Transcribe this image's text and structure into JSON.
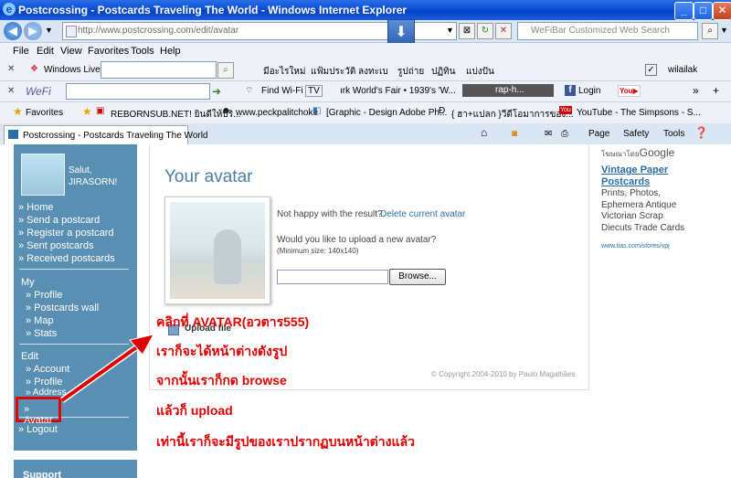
{
  "window": {
    "title": "Postcrossing - Postcards Traveling The World - Windows Internet Explorer"
  },
  "address_bar": {
    "url": "http://www.postcrossing.com/edit/avatar",
    "search_placeholder": "WeFiBar Customized Web Search"
  },
  "menu": [
    "File",
    "Edit",
    "View",
    "Favorites",
    "Tools",
    "Help"
  ],
  "toolbar_live": {
    "label": "Windows Live",
    "links": [
      "มีอะไรใหม่",
      "แฟ้มประวัติ",
      "ลงทะเบ",
      "รูปถ่าย",
      "ปฏิทิน",
      "แบ่งปัน"
    ],
    "user": "wilailak"
  },
  "toolbar_wefi": {
    "label": "WeFi",
    "find_wifi": "Find Wi-Fi",
    "tv": "TV",
    "ticker": "ırk World's Fair • 1939's 'W...",
    "media": "rap-h...",
    "login": "Login"
  },
  "favorites_bar": {
    "label": "Favorites",
    "items": [
      "REBORNSUB.NET! ยินดีให้บริ...",
      "www.peckpalitchoke",
      "[Graphic - Design Adobe Ph...",
      "{ ฮา+แปลก }วีดีโอมาการของ...",
      "YouTube - The Simpsons - S..."
    ]
  },
  "tab": {
    "title": "Postcrossing - Postcards Traveling The World",
    "commands": [
      "Page",
      "Safety",
      "Tools"
    ]
  },
  "sidebar": {
    "greeting": "Salut, JIRASORN!",
    "nav": [
      "» Home",
      "» Send a postcard",
      "» Register a postcard",
      "» Sent postcards",
      "» Received postcards"
    ],
    "my_heading": "My",
    "my_items": [
      "» Profile",
      "» Postcards wall",
      "» Map",
      "» Stats"
    ],
    "edit_heading": "Edit",
    "edit_items": [
      "» Account",
      "» Profile",
      "» Address",
      "» Avatar"
    ],
    "logout": "» Logout",
    "support": "Support"
  },
  "content": {
    "title": "Your avatar",
    "not_happy": "Not happy with the result?",
    "delete_link": "Delete current avatar",
    "upload_question": "Would you like to upload a new avatar?",
    "min_size": "(Minimum size: 140x140)",
    "browse": "Browse...",
    "upload_file": "Upload file",
    "copyright": "© Copyright 2004-2010 by Paulo Magalhães"
  },
  "ad": {
    "by": "โฆษณาโดย",
    "google": "Google",
    "headline": "Vintage Paper Postcards",
    "text": "Prints, Photos, Ephemera Antique Victorian Scrap Diecuts Trade Cards",
    "url": "www.tias.com/stores/vpj"
  },
  "annotations": [
    "คลิกที่ AVATAR(อวตาร555)",
    "เราก็จะได้หน้าต่างดังรูป",
    "จากนั้นเราก็กด browse",
    "แล้วก็ upload",
    "เท่านี้เราก็จะมีรูปของเราปรากฏบนหน้าต่างแล้ว"
  ],
  "colors": {
    "sidebar": "#5a8fb4",
    "annotation": "#e00000",
    "title_blue": "#4a7ea8"
  }
}
